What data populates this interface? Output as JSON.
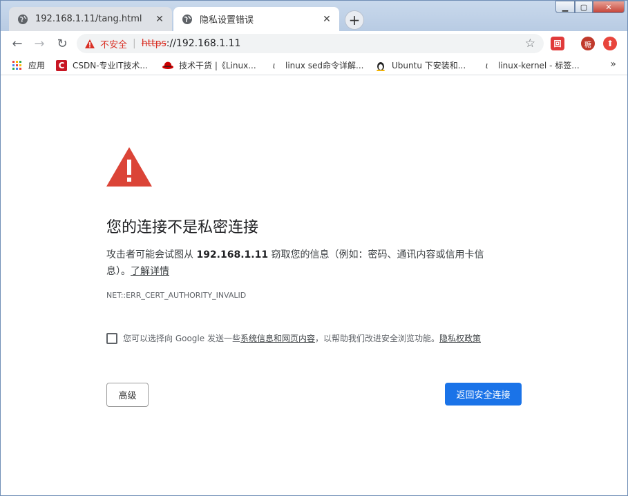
{
  "window": {
    "minimize": "▁",
    "maximize": "▢",
    "close": "✕"
  },
  "tabs": [
    {
      "title": "192.168.1.11/tang.html",
      "icon": "globe-icon"
    },
    {
      "title": "隐私设置错误",
      "icon": "globe-icon"
    }
  ],
  "toolbar": {
    "insecure_label": "不安全",
    "url_scheme": "https",
    "url_rest": "://192.168.1.11"
  },
  "bookmarks": [
    {
      "label": "应用",
      "icon": "apps-icon"
    },
    {
      "label": "CSDN-专业IT技术...",
      "icon": "csdn-icon"
    },
    {
      "label": "技术干货 |《Linux...",
      "icon": "redhat-icon"
    },
    {
      "label": "linux sed命令详解...",
      "icon": "bookmark-site-icon"
    },
    {
      "label": "Ubuntu 下安装和...",
      "icon": "tux-icon"
    },
    {
      "label": "linux-kernel - 标签...",
      "icon": "bookmark-site-icon"
    }
  ],
  "page": {
    "heading": "您的连接不是私密连接",
    "desc_before": "攻击者可能会试图从 ",
    "desc_host": "192.168.1.11",
    "desc_after": " 窃取您的信息（例如：密码、通讯内容或信用卡信息）。",
    "learn_more": "了解详情",
    "error_code": "NET::ERR_CERT_AUTHORITY_INVALID",
    "optin_before": "您可以选择向 Google 发送一些",
    "optin_link": "系统信息和网页内容",
    "optin_after": "，以帮助我们改进安全浏览功能。",
    "privacy_link": "隐私权政策",
    "advanced_button": "高级",
    "back_button": "返回安全连接"
  },
  "colors": {
    "danger": "#d93025",
    "primary": "#1a73e8",
    "warning_icon": "#db4437"
  }
}
